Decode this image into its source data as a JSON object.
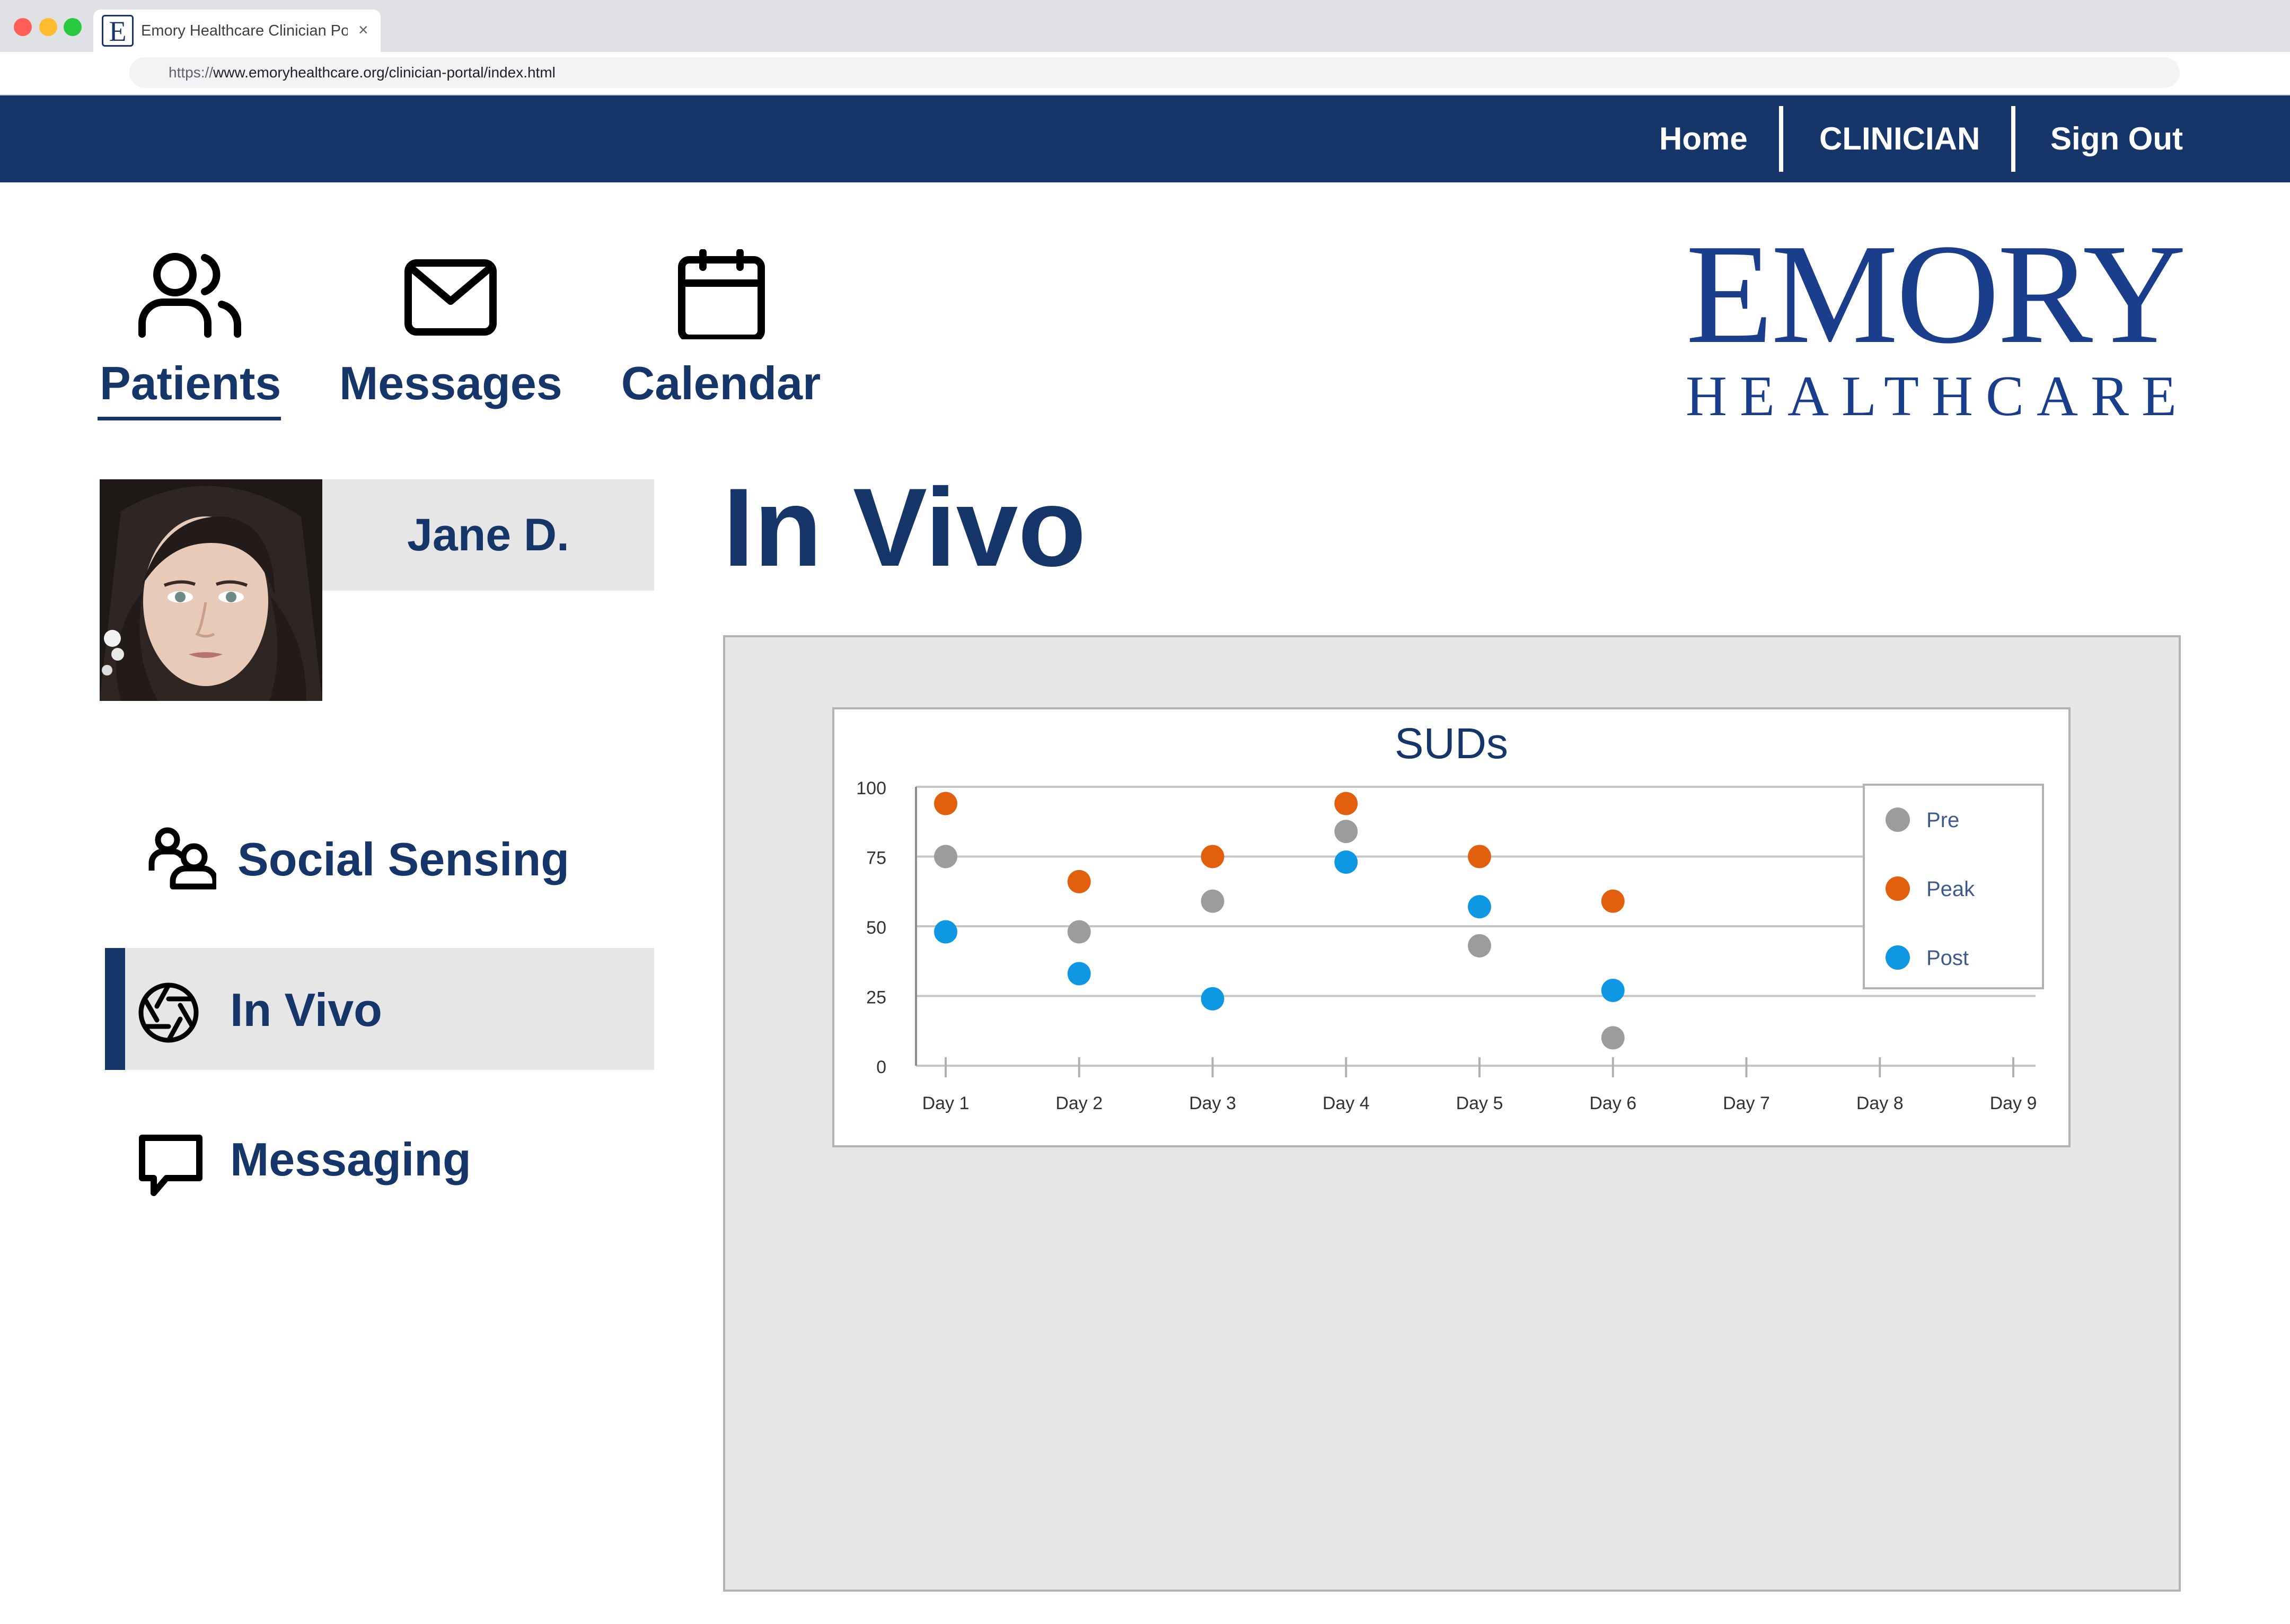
{
  "browser": {
    "tab_title": "Emory Healthcare Clinician Por",
    "tab_favicon_letter": "E",
    "tab_close": "×",
    "url_scheme": "https://",
    "url_rest": "www.emoryhealthcare.org/clinician-portal/index.html"
  },
  "topnav": {
    "home": "Home",
    "clinician": "CLINICIAN",
    "signout": "Sign Out"
  },
  "tabs": {
    "patients": "Patients",
    "messages": "Messages",
    "calendar": "Calendar",
    "active": "patients"
  },
  "logo": {
    "line1": "EMORY",
    "line2": "HEALTHCARE"
  },
  "patient": {
    "name": "Jane D."
  },
  "sidebar": {
    "items": [
      {
        "label": "Social Sensing",
        "icon": "people-icon",
        "active": false
      },
      {
        "label": "In Vivo",
        "icon": "aperture-icon",
        "active": true
      },
      {
        "label": "Messaging",
        "icon": "chat-icon",
        "active": false
      }
    ]
  },
  "main": {
    "title": "In Vivo"
  },
  "colors": {
    "navy": "#16366a",
    "pre": "#9b9c9e",
    "peak": "#e2600d",
    "post": "#0e97e3"
  },
  "chart_data": {
    "type": "scatter",
    "title": "SUDs",
    "xlabel": "",
    "ylabel": "",
    "categories": [
      "Day 1",
      "Day 2",
      "Day 3",
      "Day 4",
      "Day 5",
      "Day 6",
      "Day 7",
      "Day 8",
      "Day 9"
    ],
    "ylim": [
      0,
      100
    ],
    "yticks": [
      0,
      25,
      50,
      75,
      100
    ],
    "grid": true,
    "legend_position": "top-right",
    "series": [
      {
        "name": "Pre",
        "color": "#9b9c9e",
        "values": [
          75,
          48,
          59,
          84,
          43,
          10,
          null,
          null,
          null
        ]
      },
      {
        "name": "Peak",
        "color": "#e2600d",
        "values": [
          94,
          66,
          75,
          94,
          75,
          59,
          null,
          null,
          null
        ]
      },
      {
        "name": "Post",
        "color": "#0e97e3",
        "values": [
          48,
          33,
          24,
          73,
          57,
          27,
          null,
          null,
          null
        ]
      }
    ]
  }
}
